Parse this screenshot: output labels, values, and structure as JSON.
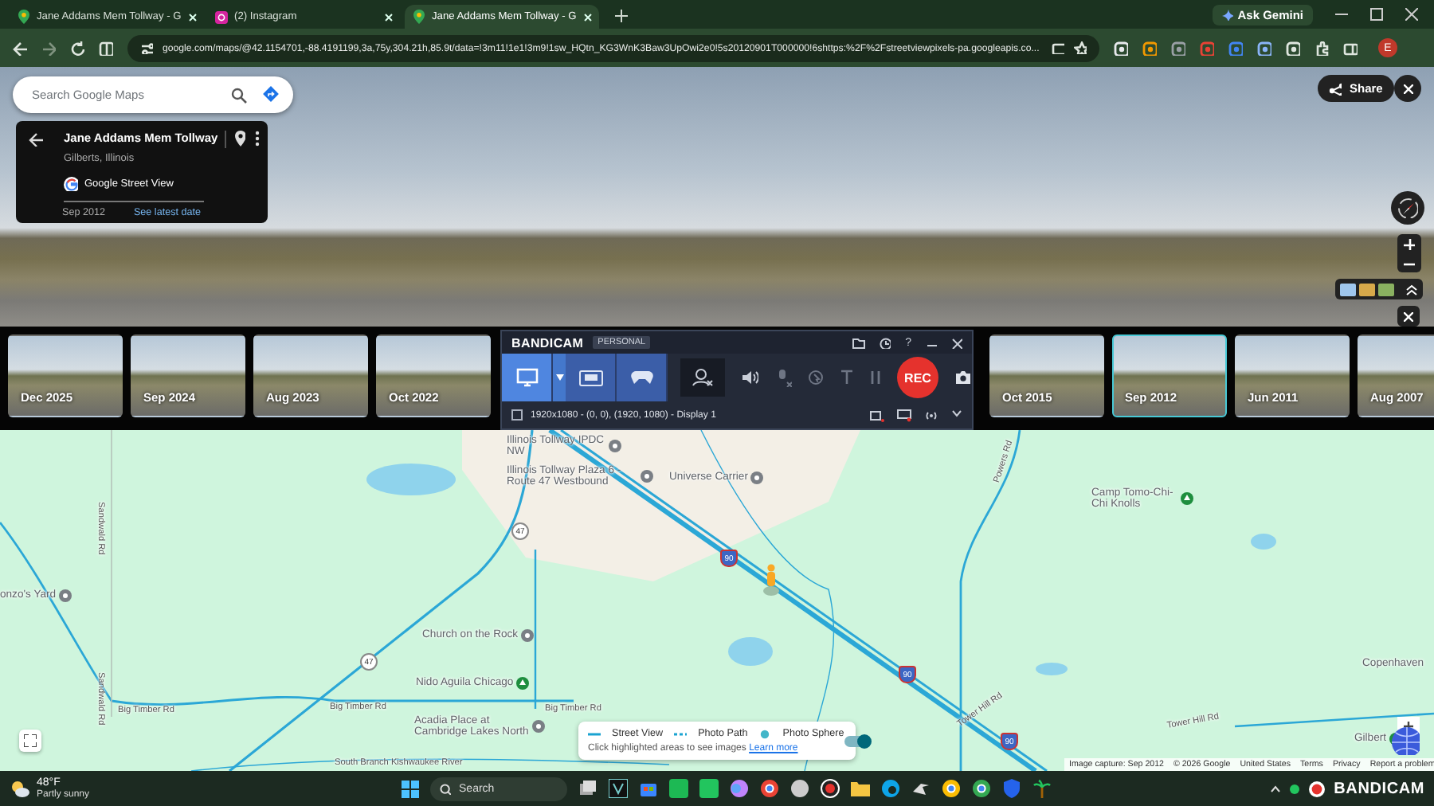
{
  "browser": {
    "tabs": [
      {
        "kind": "maps",
        "title": "Jane Addams Mem Tollway - G",
        "selected": false
      },
      {
        "kind": "instagram",
        "title": "(2) Instagram",
        "selected": false
      },
      {
        "kind": "maps",
        "title": "Jane Addams Mem Tollway - G",
        "selected": true
      }
    ],
    "ask_button": "Ask Gemini",
    "url": "google.com/maps/@42.1154701,-88.4191199,3a,75y,304.21h,85.9t/data=!3m11!1e1!3m9!1sw_HQtn_KG3WnK3Baw3UpOwi2e0!5s20120901T000000!6shttps:%2F%2Fstreetviewpixels-pa.googleapis.co...",
    "profile_initial": "E"
  },
  "street_view": {
    "search": {
      "placeholder": "Search Google Maps"
    },
    "place": {
      "title": "Jane Addams Mem Tollway",
      "subtitle": "Gilberts, Illinois",
      "source": "Google Street View",
      "date": "Sep 2012",
      "link": "See latest date"
    },
    "share": "Share"
  },
  "timeline_left": [
    {
      "label": "Dec 2025",
      "selected": false
    },
    {
      "label": "Sep 2024",
      "selected": false
    },
    {
      "label": "Aug 2023",
      "selected": false
    },
    {
      "label": "Oct 2022",
      "selected": false
    }
  ],
  "recorder": {
    "logo": "BANDICAM",
    "edition": "PERSONAL",
    "help": "?",
    "modes": [
      {
        "kind": "screen",
        "selected": true
      },
      {
        "kind": "rectangle",
        "selected": false
      },
      {
        "kind": "game",
        "selected": false
      }
    ],
    "rec": "REC",
    "area": "1920x1080 - (0, 0), (1920, 1080) - Display 1"
  },
  "timeline_right": [
    {
      "label": "Oct 2015",
      "selected": false
    },
    {
      "label": "Sep 2012",
      "selected": true
    },
    {
      "label": "Jun 2011",
      "selected": false
    },
    {
      "label": "Aug 2007",
      "selected": false
    }
  ],
  "map": {
    "labels": [
      {
        "kind": "poi",
        "text": "Illinois Tollway IPDC NW"
      },
      {
        "kind": "poi",
        "text": "Illinois Tollway Plaza 6 - Route 47 Westbound"
      },
      {
        "kind": "poi",
        "text": "Universe Carrier"
      },
      {
        "kind": "park",
        "text": "Camp Tomo-Chi-Chi Knolls"
      },
      {
        "kind": "poi",
        "text": "onzo's Yard"
      },
      {
        "kind": "poi",
        "text": "Church on the Rock"
      },
      {
        "kind": "park",
        "text": "Nido Aguila Chicago"
      },
      {
        "kind": "poi",
        "text": "Acadia Place at Cambridge Lakes North"
      },
      {
        "kind": "area",
        "text": "Copenhaven"
      },
      {
        "kind": "park",
        "text": "Gilbert"
      },
      {
        "kind": "road",
        "text": "Sandwald Rd"
      },
      {
        "kind": "road",
        "text": "Sandwald Rd"
      },
      {
        "kind": "road",
        "text": "Powers Rd"
      },
      {
        "kind": "road",
        "text": "Big Timber Rd"
      },
      {
        "kind": "road",
        "text": "Big Timber Rd"
      },
      {
        "kind": "road",
        "text": "Big Timber Rd"
      },
      {
        "kind": "road",
        "text": "Tower Hill Rd"
      },
      {
        "kind": "road",
        "text": "Tower Hill Rd"
      },
      {
        "kind": "road",
        "text": "South Branch Kishwaukee River"
      },
      {
        "kind": "state_shield",
        "text": "47"
      },
      {
        "kind": "state_shield",
        "text": "47"
      },
      {
        "kind": "interstate_shield",
        "text": "90"
      },
      {
        "kind": "interstate_shield",
        "text": "90"
      },
      {
        "kind": "interstate_shield",
        "text": "90"
      }
    ],
    "legend": {
      "items": [
        {
          "kind": "line",
          "text": "Street View"
        },
        {
          "kind": "dashed",
          "text": "Photo Path"
        },
        {
          "kind": "dot",
          "text": "Photo Sphere"
        }
      ],
      "hint": "Click highlighted areas to see images",
      "link": "Learn more",
      "toggle": {
        "on": true
      }
    },
    "footer": [
      "Image capture: Sep 2012",
      "© 2026 Google",
      "United States",
      "Terms",
      "Privacy",
      "Report a problem"
    ]
  },
  "taskbar": {
    "weather": {
      "temp": "48°F",
      "condition": "Partly sunny"
    },
    "search": {
      "placeholder": "Search"
    },
    "watermark": "BANDICAM"
  }
}
